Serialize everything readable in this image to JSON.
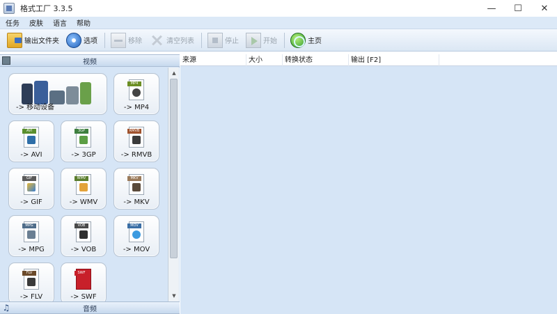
{
  "window": {
    "title": "格式工厂 3.3.5",
    "controls": {
      "minimize": "—",
      "maximize": "☐",
      "close": "✕"
    }
  },
  "menubar": {
    "items": [
      "任务",
      "皮肤",
      "语言",
      "帮助"
    ]
  },
  "toolbar": {
    "buttons": [
      {
        "label": "输出文件夹",
        "icon": "folder-icon",
        "enabled": true
      },
      {
        "label": "选项",
        "icon": "options-icon",
        "enabled": true
      },
      {
        "label": "移除",
        "icon": "remove-icon",
        "enabled": false
      },
      {
        "label": "清空列表",
        "icon": "clear-icon",
        "enabled": false
      },
      {
        "label": "停止",
        "icon": "stop-icon",
        "enabled": false
      },
      {
        "label": "开始",
        "icon": "start-icon",
        "enabled": false
      },
      {
        "label": "主页",
        "icon": "home-icon",
        "enabled": true
      }
    ]
  },
  "left_panel": {
    "video_section": "视频",
    "audio_section": "音频",
    "tiles": [
      {
        "label": "-> 移动设备",
        "badge": ""
      },
      {
        "label": "-> MP4",
        "badge": "MP4"
      },
      {
        "label": "-> AVI",
        "badge": "AVI"
      },
      {
        "label": "-> 3GP",
        "badge": "3GP"
      },
      {
        "label": "-> RMVB",
        "badge": "RMVB"
      },
      {
        "label": "-> GIF",
        "badge": "GIF"
      },
      {
        "label": "-> WMV",
        "badge": "WMV"
      },
      {
        "label": "-> MKV",
        "badge": "MKV"
      },
      {
        "label": "-> MPG",
        "badge": "MPG"
      },
      {
        "label": "-> VOB",
        "badge": "VOB"
      },
      {
        "label": "-> MOV",
        "badge": "MOV"
      },
      {
        "label": "-> FLV",
        "badge": "FLV"
      },
      {
        "label": "-> SWF",
        "badge": "SWF"
      }
    ]
  },
  "task_list": {
    "columns": [
      "来源",
      "大小",
      "转换状态",
      "输出 [F2]"
    ],
    "rows": []
  },
  "colors": {
    "panel_bg": "#d6e5f6",
    "menubar_bg": "#dce9f7"
  }
}
